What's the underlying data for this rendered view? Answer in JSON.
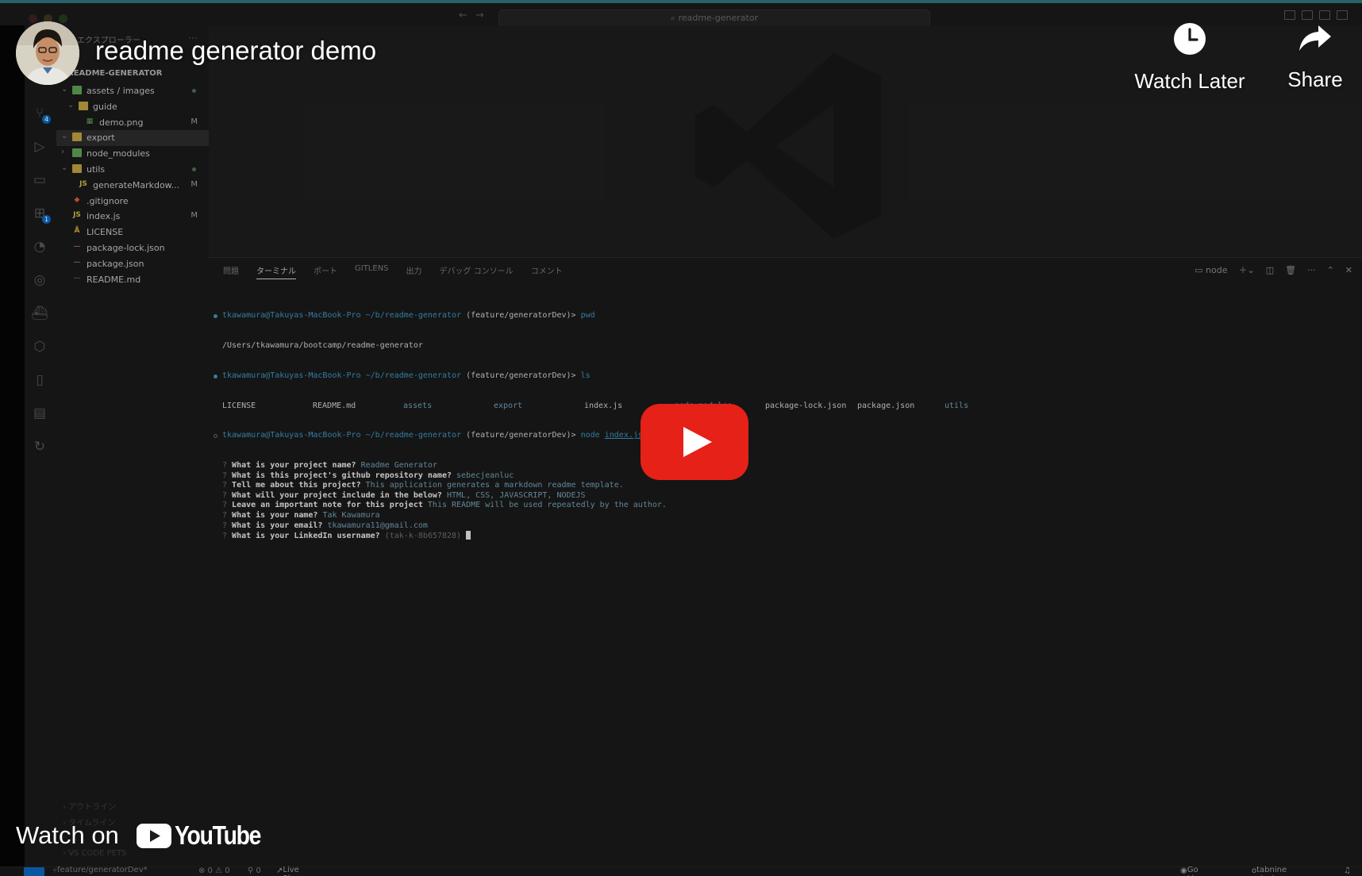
{
  "video": {
    "title": "readme generator demo",
    "watch_later_label": "Watch Later",
    "share_label": "Share",
    "watch_on_label": "Watch on",
    "youtube_label": "YouTube"
  },
  "colors": {
    "youtube_red": "#e62117",
    "accent_cyan": "#3b8fb8",
    "folder_yellow": "#b89a3e"
  },
  "vscode": {
    "command_center": "readme-generator",
    "explorer_header": "エクスプローラー",
    "project_root": "README-GENERATOR",
    "tree": [
      {
        "name": "assets / images",
        "indent": 1,
        "chev": "⌄",
        "kind": "folder-green",
        "status": "dot"
      },
      {
        "name": "guide",
        "indent": 2,
        "chev": "⌄",
        "kind": "folder",
        "status": ""
      },
      {
        "name": "demo.png",
        "indent": 3,
        "chev": "",
        "kind": "image",
        "status": "M"
      },
      {
        "name": "export",
        "indent": 1,
        "chev": "⌄",
        "kind": "folder",
        "status": "",
        "selected": true
      },
      {
        "name": "node_modules",
        "indent": 1,
        "chev": "›",
        "kind": "folder-green",
        "status": ""
      },
      {
        "name": "utils",
        "indent": 1,
        "chev": "⌄",
        "kind": "folder",
        "status": "dot"
      },
      {
        "name": "generateMarkdow...",
        "indent": 2,
        "chev": "",
        "kind": "js",
        "status": "M"
      },
      {
        "name": ".gitignore",
        "indent": 1,
        "chev": "",
        "kind": "git",
        "status": ""
      },
      {
        "name": "index.js",
        "indent": 1,
        "chev": "",
        "kind": "js",
        "status": "M"
      },
      {
        "name": "LICENSE",
        "indent": 1,
        "chev": "",
        "kind": "license",
        "status": ""
      },
      {
        "name": "package-lock.json",
        "indent": 1,
        "chev": "",
        "kind": "json",
        "status": ""
      },
      {
        "name": "package.json",
        "indent": 1,
        "chev": "",
        "kind": "json",
        "status": ""
      },
      {
        "name": "README.md",
        "indent": 1,
        "chev": "",
        "kind": "md",
        "status": ""
      }
    ],
    "panel_tabs": [
      "問題",
      "ターミナル",
      "ポート",
      "GITLENS",
      "出力",
      "デバッグ コンソール",
      "コメント"
    ],
    "panel_active_tab": "ターミナル",
    "terminal_name": "node",
    "terminal": {
      "prompt_user": "tkawamura@Takuyas-MacBook-Pro",
      "prompt_path": "~/b/readme-generator",
      "prompt_branch": "(feature/generatorDev)>",
      "cmd1": "pwd",
      "out1": "/Users/tkawamura/bootcamp/readme-generator",
      "cmd2": "ls",
      "ls_items": [
        "LICENSE",
        "README.md",
        "assets",
        "export",
        "index.js",
        "node_modules",
        "package-lock.json",
        "package.json",
        "utils"
      ],
      "cmd3_prefix": "node",
      "cmd3_file": "index.js",
      "qa": [
        {
          "q": "What is your project name?",
          "a": "Readme Generator"
        },
        {
          "q": "What is this project's github repository name?",
          "a": "sebecjeanluc"
        },
        {
          "q": "Tell me about this project?",
          "a": "This application generates a markdown readme template."
        },
        {
          "q": "What will your project include in the below?",
          "a": "HTML, CSS, JAVASCRIPT, NODEJS"
        },
        {
          "q": "Leave an important note for this project",
          "a": "This README will be used repeatedly by the author."
        },
        {
          "q": "What is your name?",
          "a": "Tak Kawamura"
        },
        {
          "q": "What is your email?",
          "a": "tkawamura11@gmail.com"
        },
        {
          "q": "What is your LinkedIn username?",
          "a": "(tak-k-8b657828)"
        }
      ]
    },
    "outline_rows": [
      "アウトライン",
      "タイムライン",
      "VS CODE PETS"
    ],
    "status": {
      "branch": "feature/generatorDev*",
      "problems": "⊗ 0 ⚠ 0",
      "ports": "⚲ 0",
      "live_share": "Live Share",
      "go_live": "Go Live",
      "tabnine": "tabnine starter"
    }
  }
}
